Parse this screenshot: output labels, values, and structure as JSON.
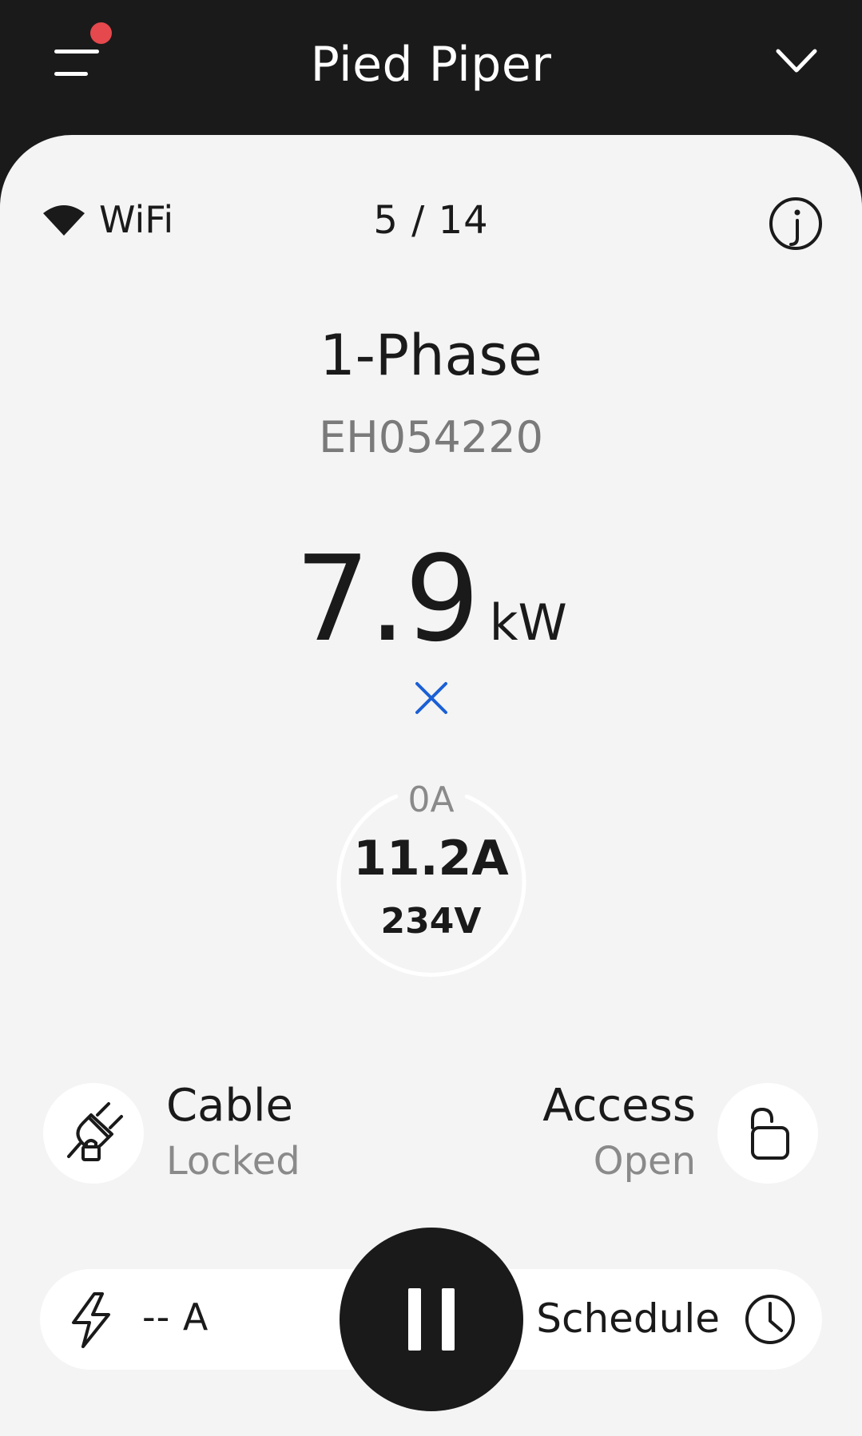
{
  "header": {
    "title": "Pied Piper",
    "menu_icon": "menu-icon",
    "notification_dot_color": "#e5484d",
    "dropdown_icon": "chevron-down-icon"
  },
  "status": {
    "connection_label": "WiFi",
    "connection_icon": "wifi-icon",
    "page_indicator": "5 / 14",
    "info_icon": "info-icon"
  },
  "charger": {
    "phase": "1-Phase",
    "serial": "EH054220",
    "power_value": "7.9",
    "power_unit": "kW",
    "status_icon": "x-icon",
    "status_color": "#1a5fd6"
  },
  "gauge": {
    "min_label": "0A",
    "current": "11.2A",
    "voltage": "234V"
  },
  "cable": {
    "title": "Cable",
    "status": "Locked",
    "icon": "cable-lock-icon"
  },
  "access": {
    "title": "Access",
    "status": "Open",
    "icon": "unlock-icon"
  },
  "controls": {
    "current_limit": "-- A",
    "current_icon": "bolt-icon",
    "pause_icon": "pause-icon",
    "schedule_label": "Schedule",
    "schedule_icon": "clock-icon"
  }
}
